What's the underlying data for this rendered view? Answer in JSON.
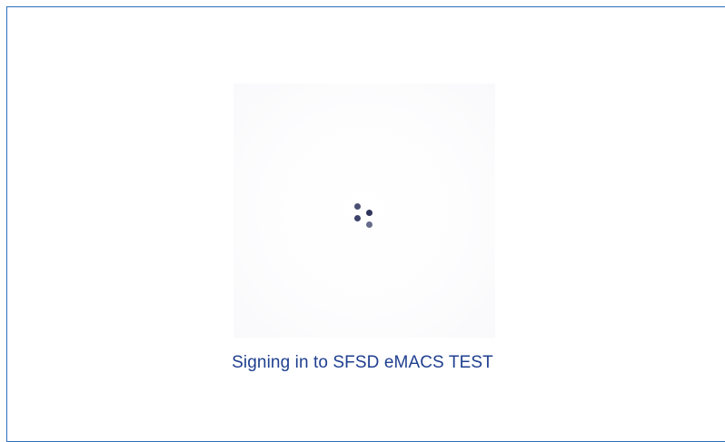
{
  "status": {
    "message": "Signing in to SFSD eMACS TEST"
  },
  "loader": {
    "icon": "loading-spinner-icon",
    "dot_color": "#3a3f66"
  },
  "colors": {
    "frame_border": "#2e6fbf",
    "text": "#1f3f8f",
    "background": "#ffffff"
  }
}
